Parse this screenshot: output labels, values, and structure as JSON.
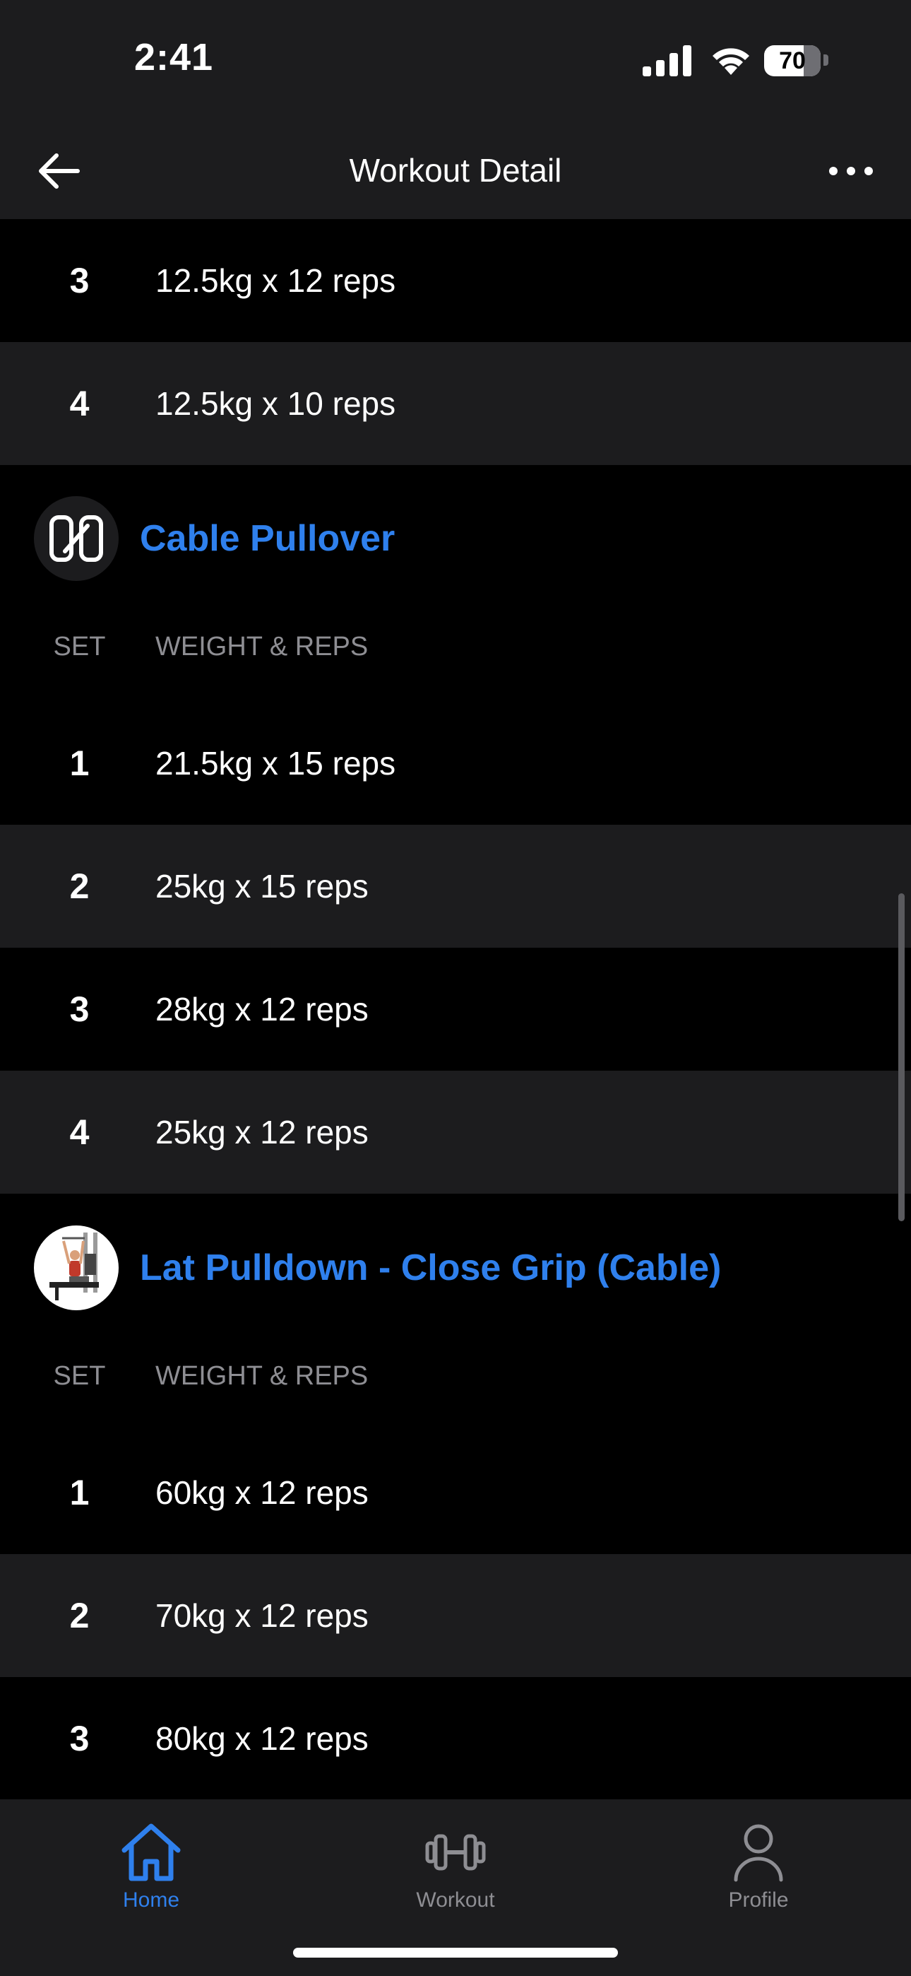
{
  "status_bar": {
    "time": "2:41",
    "battery": "70"
  },
  "nav": {
    "title": "Workout Detail"
  },
  "top_sets": [
    {
      "set": "3",
      "detail": "12.5kg x 12 reps"
    },
    {
      "set": "4",
      "detail": "12.5kg x 10 reps"
    }
  ],
  "exercises": [
    {
      "name": "Cable Pullover",
      "col_set": "SET",
      "col_weight": "WEIGHT & REPS",
      "sets": [
        {
          "set": "1",
          "detail": "21.5kg x 15 reps"
        },
        {
          "set": "2",
          "detail": "25kg x 15 reps"
        },
        {
          "set": "3",
          "detail": "28kg x 12 reps"
        },
        {
          "set": "4",
          "detail": "25kg x 12 reps"
        }
      ]
    },
    {
      "name": "Lat Pulldown - Close Grip (Cable)",
      "col_set": "SET",
      "col_weight": "WEIGHT & REPS",
      "sets": [
        {
          "set": "1",
          "detail": "60kg x 12 reps"
        },
        {
          "set": "2",
          "detail": "70kg x 12 reps"
        },
        {
          "set": "3",
          "detail": "80kg x 12 reps"
        }
      ]
    }
  ],
  "tabs": [
    {
      "label": "Home",
      "icon": "home-icon",
      "active": true
    },
    {
      "label": "Workout",
      "icon": "dumbbell-icon",
      "active": false
    },
    {
      "label": "Profile",
      "icon": "person-icon",
      "active": false
    }
  ],
  "colors": {
    "accent": "#2f80ed",
    "inactive": "#8e8e93",
    "row_alt": "#1c1c1e"
  }
}
